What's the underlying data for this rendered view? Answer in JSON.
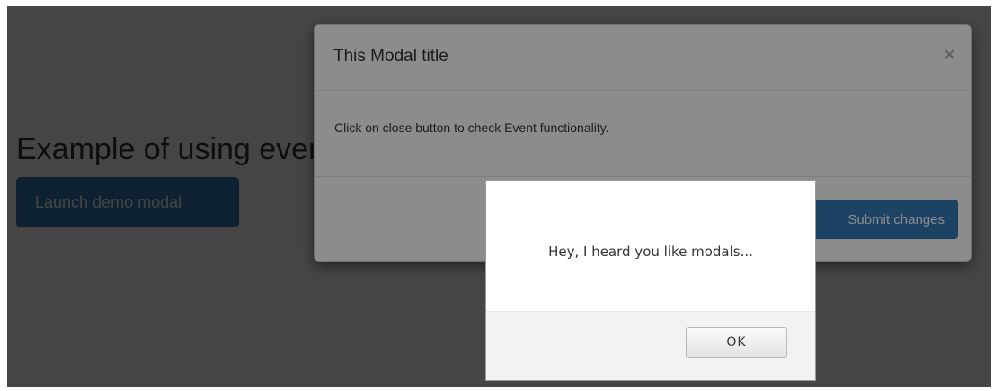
{
  "page": {
    "heading": "Example of using events",
    "launch_button_label": "Launch demo modal"
  },
  "modal": {
    "title": "This Modal title",
    "close_symbol": "×",
    "body_text": "Click on close button to check Event functionality.",
    "submit_label": "Submit changes"
  },
  "alert": {
    "message": "Hey, I heard you like modals...",
    "ok_label": "OK"
  },
  "colors": {
    "primary": "#337ab7",
    "backdrop": "rgba(0,0,0,0.5)"
  },
  "icons": {
    "close": "close-icon"
  }
}
